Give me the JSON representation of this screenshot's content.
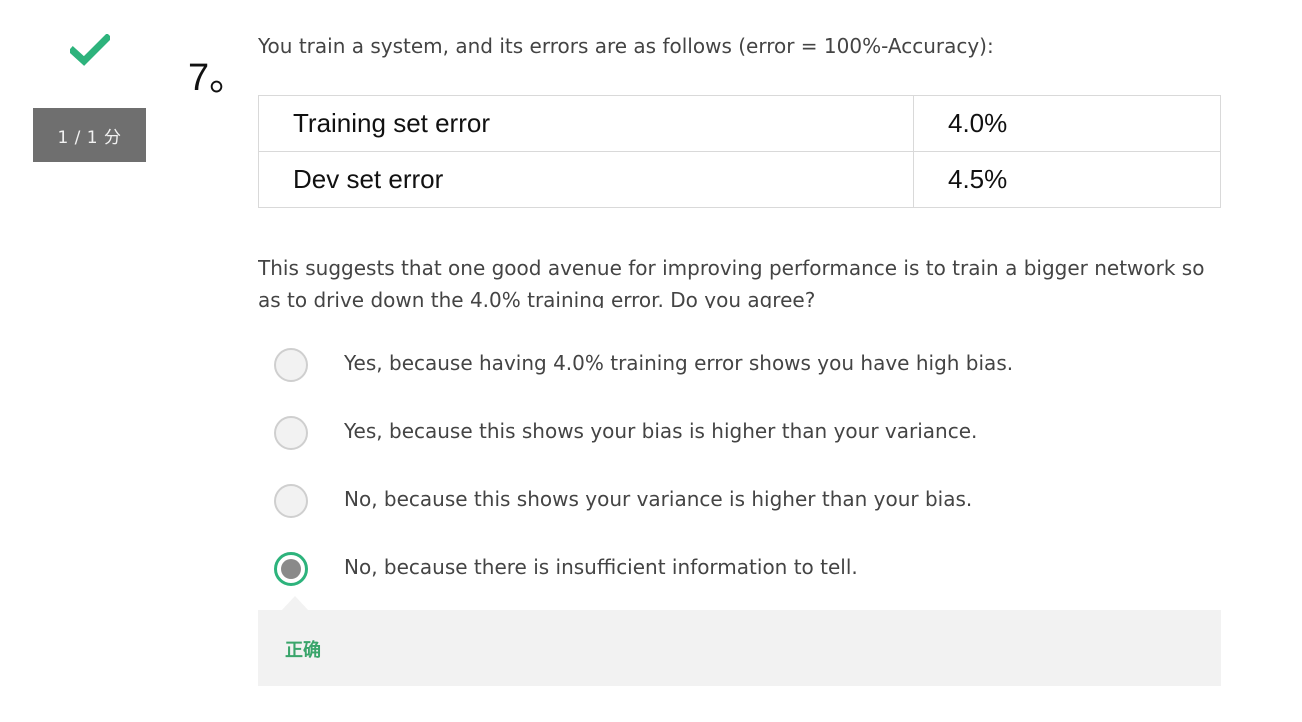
{
  "status": {
    "check_icon": "check-icon",
    "score": "1 / 1 分",
    "accent_color": "#2db37c"
  },
  "question": {
    "number": "7。",
    "intro": "You train a system, and its errors are as follows (error = 100%-Accuracy):",
    "table": [
      {
        "label": "Training set error",
        "value": "4.0%"
      },
      {
        "label": "Dev set error",
        "value": "4.5%"
      }
    ],
    "body": "This suggests that one good avenue for improving performance is to train a bigger network so as to drive down the 4.0% training error. Do you agree?"
  },
  "options": [
    {
      "label": "Yes, because having 4.0% training error shows you have high bias.",
      "selected": false
    },
    {
      "label": "Yes, because this shows your bias is higher than your variance.",
      "selected": false
    },
    {
      "label": "No, because this shows your variance is higher than your bias.",
      "selected": false
    },
    {
      "label": "No, because there is insufficient information to tell.",
      "selected": true
    }
  ],
  "feedback": {
    "text": "正确",
    "color": "#3aa56b"
  }
}
